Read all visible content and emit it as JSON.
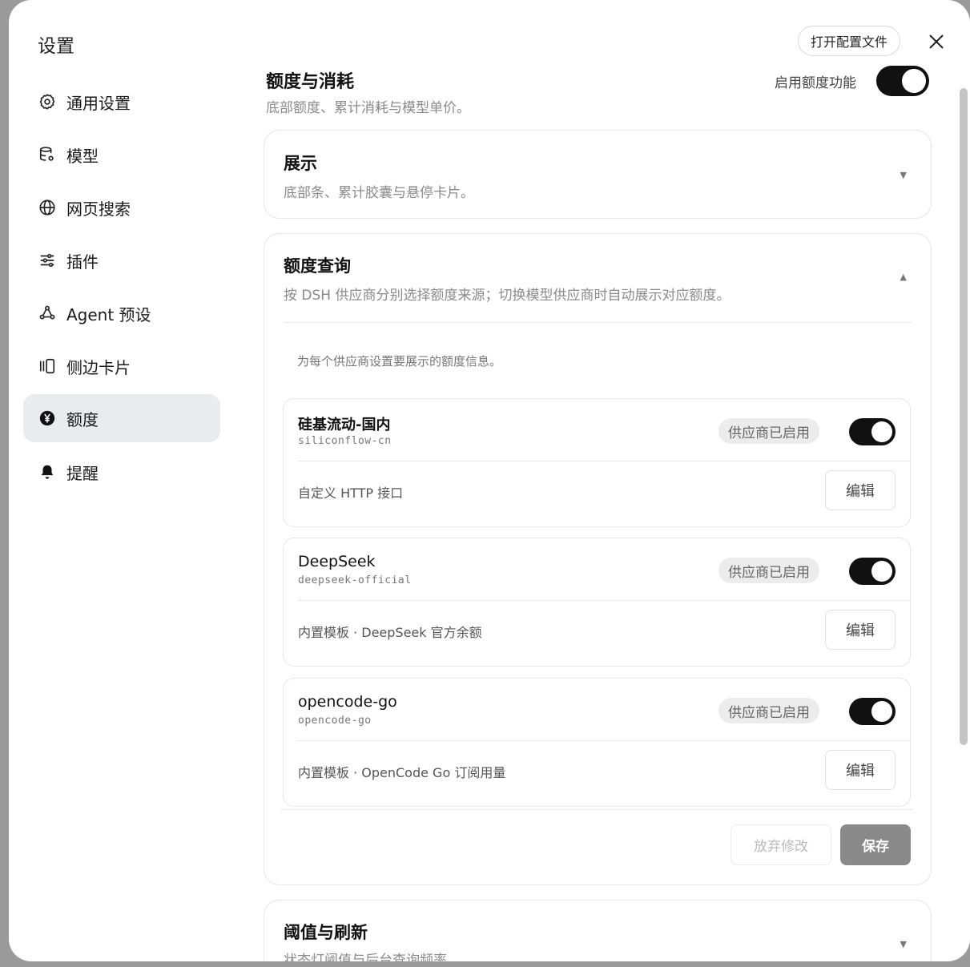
{
  "sidebar": {
    "title": "设置",
    "items": [
      {
        "label": "通用设置",
        "icon": "gear-icon"
      },
      {
        "label": "模型",
        "icon": "database-icon"
      },
      {
        "label": "网页搜索",
        "icon": "globe-icon"
      },
      {
        "label": "插件",
        "icon": "sliders-icon"
      },
      {
        "label": "Agent 预设",
        "icon": "agent-icon"
      },
      {
        "label": "侧边卡片",
        "icon": "side-card-icon"
      },
      {
        "label": "额度",
        "icon": "yen-icon",
        "active": true
      },
      {
        "label": "提醒",
        "icon": "bell-icon"
      }
    ]
  },
  "header": {
    "open_config_label": "打开配置文件"
  },
  "section": {
    "title": "额度与消耗",
    "subtitle": "底部额度、累计消耗与模型单价。",
    "enable_label": "启用额度功能",
    "enabled": true
  },
  "cards": {
    "display": {
      "title": "展示",
      "subtitle": "底部条、累计胶囊与悬停卡片。",
      "chevron": "▼"
    },
    "quota_query": {
      "title": "额度查询",
      "subtitle": "按 DSH 供应商分别选择额度来源；切换模型供应商时自动展示对应额度。",
      "chevron": "▲",
      "hint": "为每个供应商设置要展示的额度信息。",
      "providers": [
        {
          "name": "硅基流动-国内",
          "id": "siliconflow-cn",
          "badge": "供应商已启用",
          "enabled": true,
          "desc": "自定义 HTTP 接口",
          "edit": "编辑"
        },
        {
          "name": "DeepSeek",
          "id": "deepseek-official",
          "badge": "供应商已启用",
          "enabled": true,
          "desc": "内置模板 · DeepSeek 官方余额",
          "edit": "编辑"
        },
        {
          "name": "opencode-go",
          "id": "opencode-go",
          "badge": "供应商已启用",
          "enabled": true,
          "desc": "内置模板 · OpenCode Go 订阅用量",
          "edit": "编辑"
        }
      ],
      "discard_label": "放弃修改",
      "save_label": "保存"
    },
    "threshold": {
      "title": "阈值与刷新",
      "subtitle": "状态灯阈值与后台查询频率",
      "chevron": "▼"
    }
  }
}
